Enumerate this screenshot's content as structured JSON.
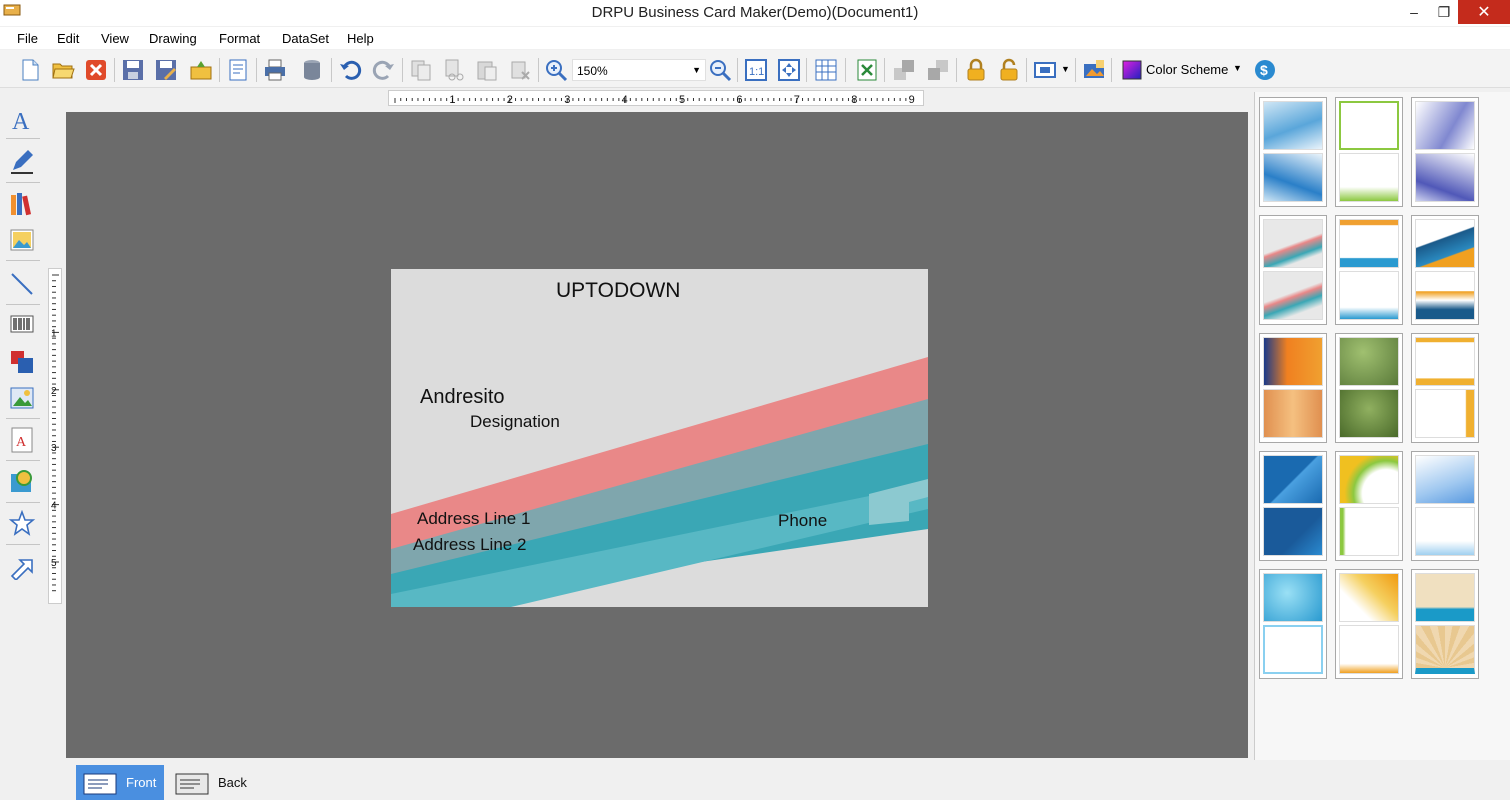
{
  "window": {
    "title": "DRPU Business Card Maker(Demo)(Document1)"
  },
  "controls": {
    "minimize": "–",
    "restore": "❐",
    "close": "✕"
  },
  "menu": [
    "File",
    "Edit",
    "View",
    "Drawing",
    "Format",
    "DataSet",
    "Help"
  ],
  "toolbar": {
    "zoom_value": "150%",
    "color_scheme_label": "Color Scheme"
  },
  "ruler_top_ticks": [
    "1",
    "2",
    "3",
    "4",
    "5",
    "6",
    "7",
    "8",
    "9"
  ],
  "ruler_left_ticks": [
    "1",
    "2",
    "3",
    "4",
    "5"
  ],
  "card": {
    "company": "UPTODOWN",
    "name": "Andresito",
    "designation": "Designation",
    "address1": "Address Line 1",
    "address2": "Address Line 2",
    "phone": "Phone"
  },
  "tabs": {
    "front": "Front",
    "back": "Back"
  },
  "colors": {
    "canvas": "#6b6b6b",
    "card_bg": "#dcdcdc",
    "stripe_red": "#e98888",
    "stripe_teal": "#3aa7b5",
    "active_tab": "#4a8fe0"
  }
}
